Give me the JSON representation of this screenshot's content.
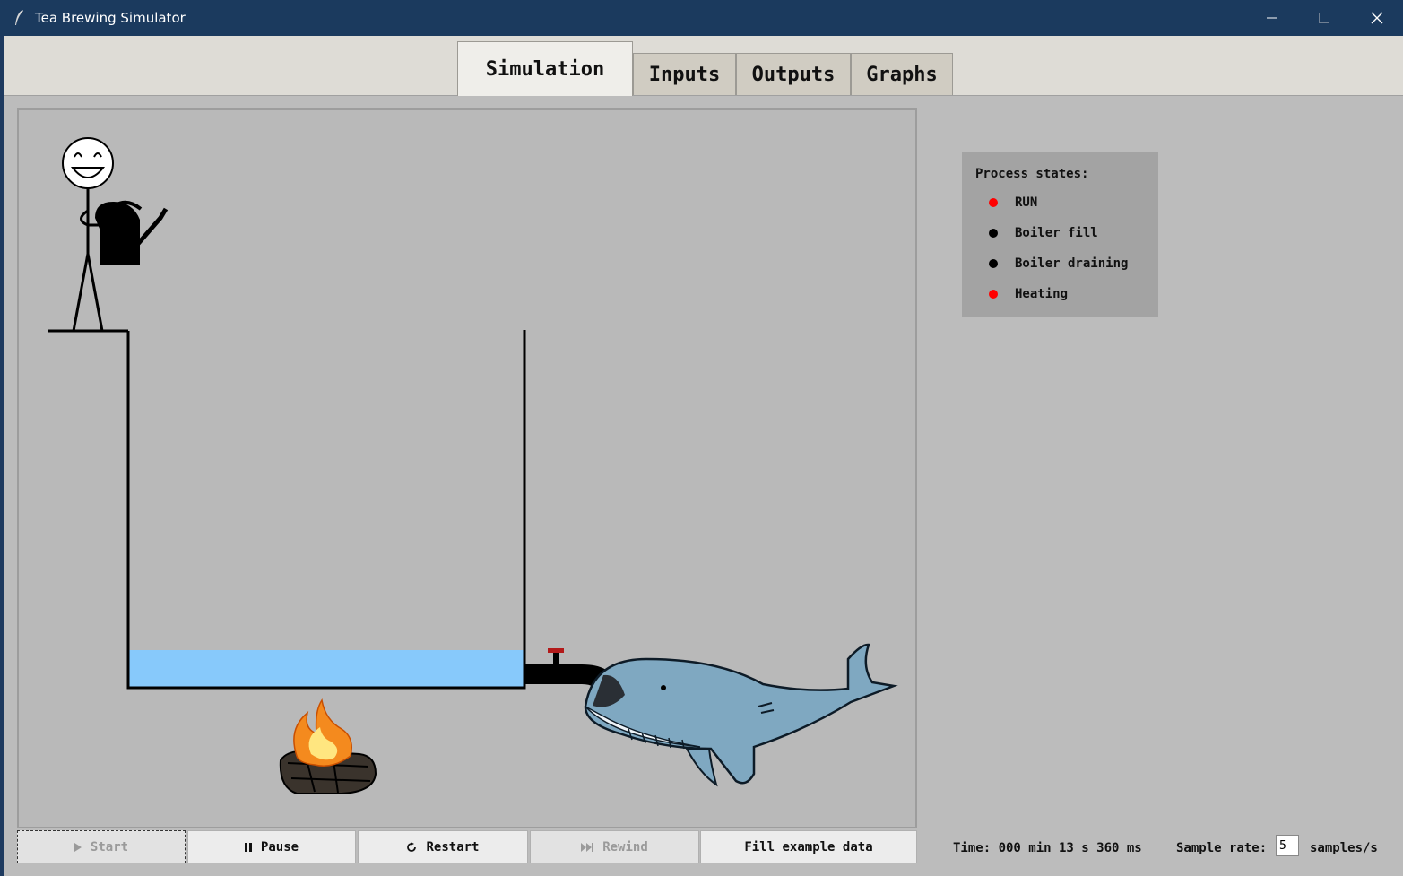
{
  "window": {
    "title": "Tea Brewing Simulator"
  },
  "tabs": [
    {
      "label": "Simulation",
      "active": true
    },
    {
      "label": "Inputs",
      "active": false
    },
    {
      "label": "Outputs",
      "active": false
    },
    {
      "label": "Graphs",
      "active": false
    }
  ],
  "legend": {
    "header": "Process states:",
    "items": [
      {
        "label": "RUN",
        "color": "#ff0000"
      },
      {
        "label": "Boiler fill",
        "color": "#000000"
      },
      {
        "label": "Boiler draining",
        "color": "#000000"
      },
      {
        "label": "Heating",
        "color": "#ff0000"
      }
    ]
  },
  "controls": {
    "start": {
      "label": "Start",
      "icon": "play-icon",
      "enabled": false
    },
    "pause": {
      "label": "Pause",
      "icon": "pause-icon",
      "enabled": true
    },
    "restart": {
      "label": "Restart",
      "icon": "restart-icon",
      "enabled": true
    },
    "rewind": {
      "label": "Rewind",
      "icon": "fast-forward-icon",
      "enabled": false
    },
    "fill": {
      "label": "Fill example data",
      "enabled": true
    }
  },
  "status": {
    "time": "Time: 000 min 13 s 360 ms",
    "sample_rate_label": "Sample rate:",
    "sample_rate_value": "5",
    "sample_rate_unit": "samples/s"
  },
  "colors": {
    "water": "#87c9fb",
    "titlebar": "#1b3a5e"
  }
}
